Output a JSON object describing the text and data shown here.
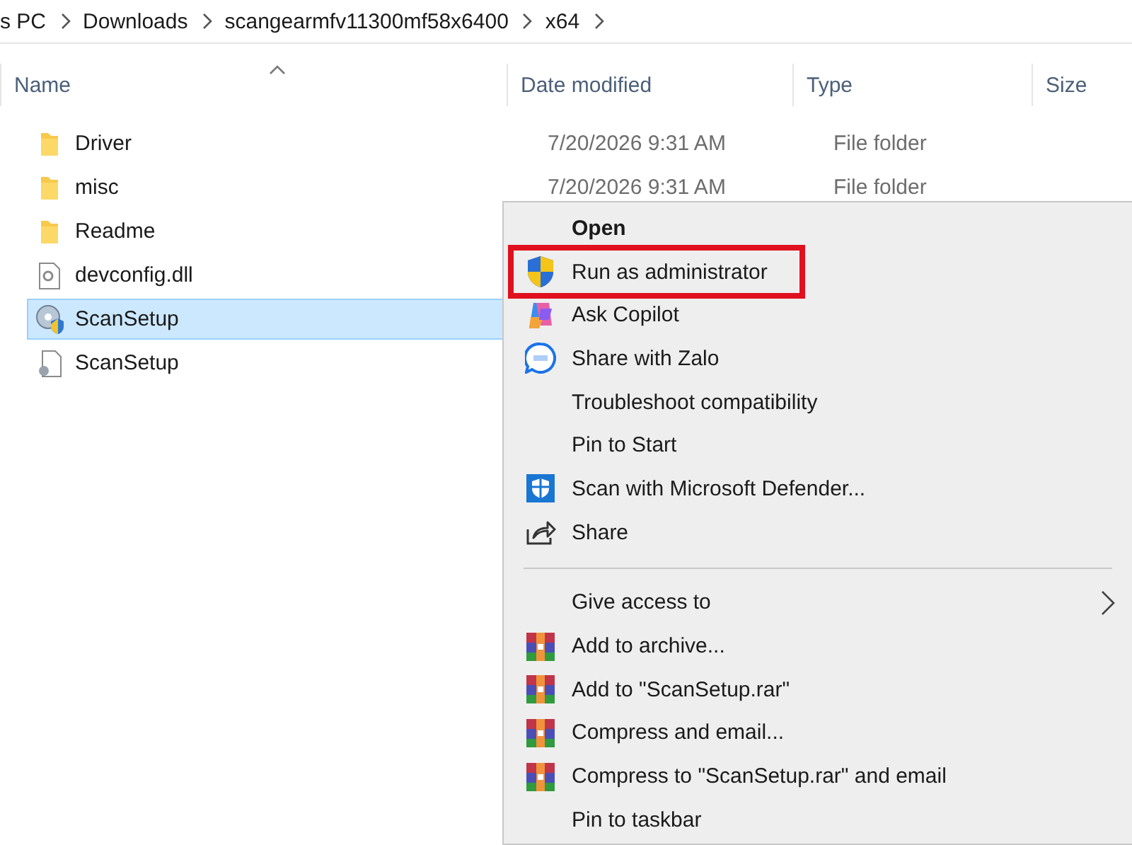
{
  "breadcrumb": [
    "s PC",
    "Downloads",
    "scangearmfv11300mf58x6400",
    "x64"
  ],
  "columns": [
    {
      "label": "Name",
      "sorted": true
    },
    {
      "label": "Date modified",
      "sorted": false
    },
    {
      "label": "Type",
      "sorted": false
    },
    {
      "label": "Size",
      "sorted": false
    }
  ],
  "files": [
    {
      "name": "Driver",
      "kind": "folder",
      "date": "7/20/2026 9:31 AM",
      "type": "File folder",
      "selected": false
    },
    {
      "name": "misc",
      "kind": "folder",
      "date": "7/20/2026 9:31 AM",
      "type": "File folder",
      "selected": false
    },
    {
      "name": "Readme",
      "kind": "folder",
      "selected": false
    },
    {
      "name": "devconfig.dll",
      "kind": "dll",
      "selected": false
    },
    {
      "name": "ScanSetup",
      "kind": "installer",
      "selected": true
    },
    {
      "name": "ScanSetup",
      "kind": "document",
      "selected": false
    }
  ],
  "context_menu": [
    {
      "label": "Open",
      "kind": "plain",
      "default": true,
      "highlighted": false
    },
    {
      "label": "Run as administrator",
      "kind": "shield",
      "default": false,
      "highlighted": true
    },
    {
      "label": "Ask Copilot",
      "kind": "copilot",
      "default": false,
      "highlighted": false
    },
    {
      "label": "Share with Zalo",
      "kind": "chat",
      "default": false,
      "highlighted": false
    },
    {
      "label": "Troubleshoot compatibility",
      "kind": "plain",
      "default": false,
      "highlighted": false
    },
    {
      "label": "Pin to Start",
      "kind": "plain",
      "default": false,
      "highlighted": false
    },
    {
      "label": "Scan with Microsoft Defender...",
      "kind": "defender",
      "default": false,
      "highlighted": false
    },
    {
      "label": "Share",
      "kind": "share",
      "default": false,
      "highlighted": false
    },
    {
      "kind": "separator"
    },
    {
      "label": "Give access to",
      "kind": "submenu",
      "default": false,
      "highlighted": false
    },
    {
      "label": "Add to archive...",
      "kind": "archive",
      "default": false,
      "highlighted": false
    },
    {
      "label": "Add to \"ScanSetup.rar\"",
      "kind": "archive",
      "default": false,
      "highlighted": false
    },
    {
      "label": "Compress and email...",
      "kind": "archive",
      "default": false,
      "highlighted": false
    },
    {
      "label": "Compress to \"ScanSetup.rar\" and email",
      "kind": "archive",
      "default": false,
      "highlighted": false
    },
    {
      "label": "Pin to taskbar",
      "kind": "plain",
      "default": false,
      "highlighted": false
    }
  ]
}
